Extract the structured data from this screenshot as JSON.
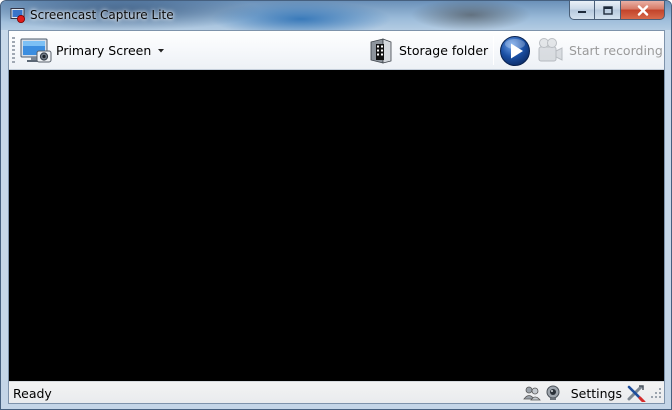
{
  "window": {
    "title": "Screencast Capture Lite"
  },
  "toolbar": {
    "screen_select": {
      "label": "Primary Screen"
    },
    "storage_folder": {
      "label": "Storage folder"
    },
    "start_recording": {
      "label": "Start recording",
      "enabled": false
    }
  },
  "status": {
    "text": "Ready",
    "settings_label": "Settings"
  },
  "colors": {
    "preview_background": "#000000",
    "play_button": "#1a4fa3"
  },
  "icons": {
    "app": "app-record-icon",
    "screen": "monitor-camera-icon",
    "dropdown": "caret-down-icon",
    "folder": "film-folder-icon",
    "play": "play-icon",
    "record": "camera-icon",
    "status_left": "people-icon",
    "status_mid": "webcam-icon",
    "settings": "tools-icon"
  }
}
